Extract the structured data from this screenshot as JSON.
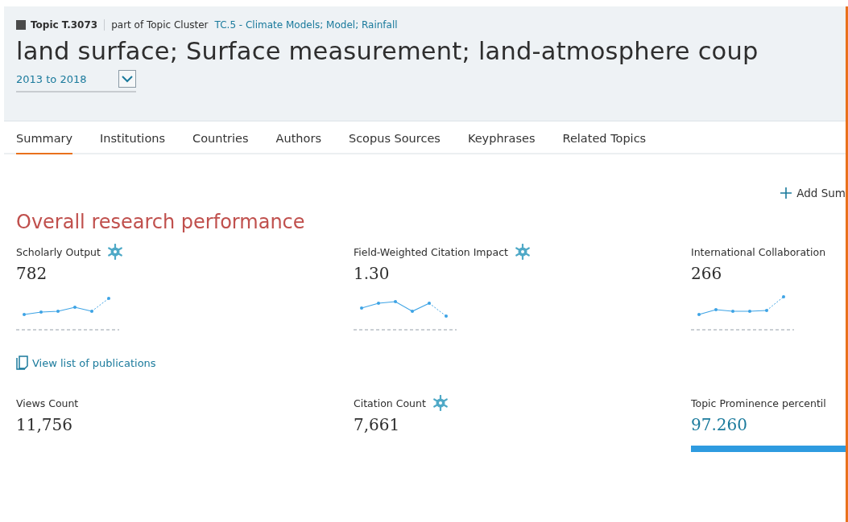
{
  "header": {
    "topic_label": "Topic T.3073",
    "cluster_prefix": "part of Topic Cluster",
    "cluster_link": "TC.5 - Climate Models; Model; Rainfall",
    "title": "land surface; Surface measurement; land-atmosphere coup",
    "period": "2013 to 2018"
  },
  "tabs": [
    {
      "label": "Summary",
      "selected": true
    },
    {
      "label": "Institutions",
      "selected": false
    },
    {
      "label": "Countries",
      "selected": false
    },
    {
      "label": "Authors",
      "selected": false
    },
    {
      "label": "Scopus Sources",
      "selected": false
    },
    {
      "label": "Keyphrases",
      "selected": false
    },
    {
      "label": "Related Topics",
      "selected": false
    }
  ],
  "add_summary": "Add Sum",
  "section_title": "Overall research performance",
  "metrics": [
    {
      "label": "Scholarly Output",
      "value": "782",
      "snowball": true,
      "kind": "sparkline"
    },
    {
      "label": "Field-Weighted Citation Impact",
      "value": "1.30",
      "snowball": true,
      "kind": "sparkline"
    },
    {
      "label": "International Collaboration",
      "value": "266",
      "snowball": false,
      "kind": "sparkline"
    }
  ],
  "publications_link": "View list of publications",
  "metrics_2": [
    {
      "label": "Views Count",
      "value": "11,756",
      "snowball": false,
      "kind": "plain"
    },
    {
      "label": "Citation Count",
      "value": "7,661",
      "snowball": true,
      "kind": "plain"
    },
    {
      "label": "Topic Prominence percentil",
      "value": "97.260",
      "snowball": false,
      "kind": "prominence"
    }
  ]
}
